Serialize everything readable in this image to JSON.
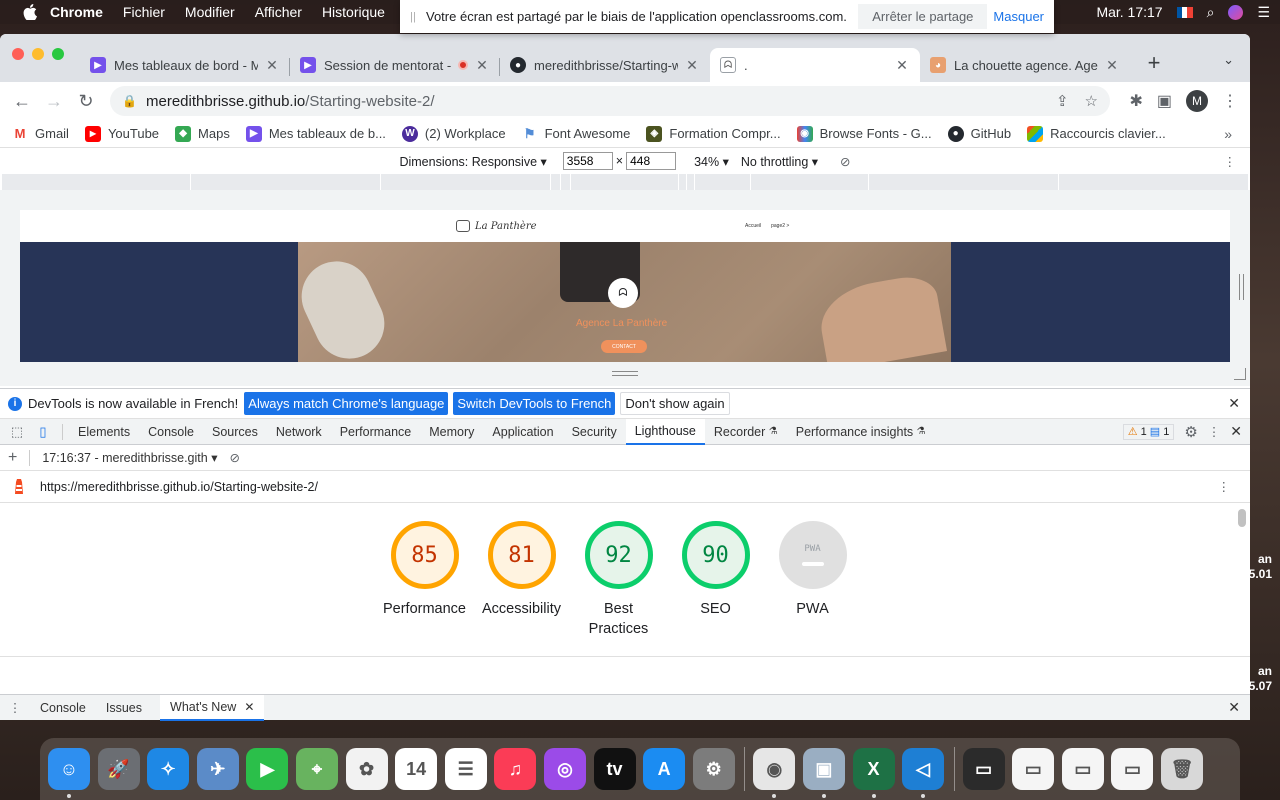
{
  "menubar": {
    "app_name": "Chrome",
    "items": [
      "Fichier",
      "Modifier",
      "Afficher",
      "Historique"
    ],
    "clock": "Mar. 17:17"
  },
  "share_banner": {
    "message": "Votre écran est partagé par le biais de l'application openclassrooms.com.",
    "stop_label": "Arrêter le partage",
    "hide_label": "Masquer"
  },
  "tabs": [
    {
      "title": "Mes tableaux de bord - M",
      "favicon_color": "#7451eb",
      "favicon": "openclassrooms-icon"
    },
    {
      "title": "Session de mentorat -",
      "favicon_color": "#7451eb",
      "favicon": "openclassrooms-icon",
      "recording": true
    },
    {
      "title": "meredithbrisse/Starting-w",
      "favicon_color": "#24292f",
      "favicon": "github-icon"
    },
    {
      "title": ".",
      "favicon_color": "#9aa0a6",
      "favicon": "panther-icon",
      "active": true
    },
    {
      "title": "La chouette agence. Ager",
      "favicon_color": "#e8a070",
      "favicon": "owl-icon"
    }
  ],
  "address": {
    "host": "meredithbrisse.github.io",
    "path": "/Starting-website-2/"
  },
  "profile_initial": "M",
  "bookmarks": [
    {
      "label": "Gmail",
      "color": "#ea4335",
      "glyph": "M"
    },
    {
      "label": "YouTube",
      "color": "#ff0000",
      "glyph": "▶"
    },
    {
      "label": "Maps",
      "color": "#34a853",
      "glyph": "◆"
    },
    {
      "label": "Mes tableaux de b...",
      "color": "#7451eb",
      "glyph": "▶"
    },
    {
      "label": "(2) Workplace",
      "color": "#4b2c9c",
      "glyph": "W"
    },
    {
      "label": "Font Awesome",
      "color": "#538dd7",
      "glyph": "⚑"
    },
    {
      "label": "Formation Compr...",
      "color": "#4b5320",
      "glyph": "◈"
    },
    {
      "label": "Browse Fonts - G...",
      "color": "#4285f4",
      "glyph": "◉"
    },
    {
      "label": "GitHub",
      "color": "#24292f",
      "glyph": "●"
    },
    {
      "label": "Raccourcis clavier...",
      "color": "#f25022",
      "glyph": "▦"
    }
  ],
  "device_toolbar": {
    "dimensions_label": "Dimensions: Responsive",
    "width": "3558",
    "height": "448",
    "zoom": "34%",
    "throttling": "No throttling"
  },
  "site": {
    "logo_text": "La Panthère",
    "nav": [
      "Accueil",
      "page2 >"
    ],
    "hero_title": "Agence La Panthère",
    "hero_button": "CONTACT"
  },
  "devtools": {
    "infobar": {
      "message": "DevTools is now available in French!",
      "btn_match": "Always match Chrome's language",
      "btn_switch": "Switch DevTools to French",
      "btn_dismiss": "Don't show again"
    },
    "tabs": [
      "Elements",
      "Console",
      "Sources",
      "Network",
      "Performance",
      "Memory",
      "Application",
      "Security",
      "Lighthouse",
      "Recorder",
      "Performance insights"
    ],
    "active_tab": "Lighthouse",
    "warnings_count": "1",
    "messages_count": "1",
    "lighthouse": {
      "report_time": "17:16:37 - meredithbrisse.gith",
      "url": "https://meredithbrisse.github.io/Starting-website-2/",
      "scores": [
        {
          "label": "Performance",
          "value": "85",
          "status": "orange"
        },
        {
          "label": "Accessibility",
          "value": "81",
          "status": "orange"
        },
        {
          "label": "Best Practices",
          "value": "92",
          "status": "green"
        },
        {
          "label": "SEO",
          "value": "90",
          "status": "green"
        },
        {
          "label": "PWA",
          "value": "",
          "status": "grey",
          "badge": "PWA"
        }
      ]
    },
    "drawer_tabs": [
      "Console",
      "Issues",
      "What's New"
    ],
    "drawer_active": "What's New"
  },
  "desktop_labels": [
    {
      "line1": "an",
      "line2": "5.01"
    },
    {
      "line1": "an",
      "line2": "5.07"
    }
  ],
  "dock": [
    {
      "name": "finder-icon",
      "color": "#2e8ff0",
      "glyph": "☺",
      "running": true
    },
    {
      "name": "launchpad-icon",
      "color": "#6b6e73",
      "glyph": "🚀",
      "running": false
    },
    {
      "name": "safari-icon",
      "color": "#1e88e5",
      "glyph": "✧",
      "running": false
    },
    {
      "name": "preview-icon",
      "color": "#5b8bc8",
      "glyph": "✈",
      "running": false
    },
    {
      "name": "facetime-icon",
      "color": "#2bbf4a",
      "glyph": "▶",
      "running": false
    },
    {
      "name": "maps-icon",
      "color": "#68b35f",
      "glyph": "⌖",
      "running": false
    },
    {
      "name": "photos-icon",
      "color": "#f2f2f2",
      "glyph": "✿",
      "running": false
    },
    {
      "name": "calendar-icon",
      "color": "#ffffff",
      "glyph": "14",
      "running": false
    },
    {
      "name": "reminders-icon",
      "color": "#ffffff",
      "glyph": "☰",
      "running": false
    },
    {
      "name": "music-icon",
      "color": "#fb3c56",
      "glyph": "♫",
      "running": false
    },
    {
      "name": "podcasts-icon",
      "color": "#9b4be8",
      "glyph": "◎",
      "running": false
    },
    {
      "name": "appletv-icon",
      "color": "#111111",
      "glyph": "tv",
      "running": false
    },
    {
      "name": "appstore-icon",
      "color": "#1b8cf2",
      "glyph": "A",
      "running": false
    },
    {
      "name": "system-preferences-icon",
      "color": "#7c7c7c",
      "glyph": "⚙",
      "running": false
    },
    {
      "name": "chrome-icon",
      "color": "#e6e6e6",
      "glyph": "◉",
      "running": true
    },
    {
      "name": "preview-photos-icon",
      "color": "#9aaec2",
      "glyph": "▣",
      "running": true
    },
    {
      "name": "excel-icon",
      "color": "#1e7145",
      "glyph": "X",
      "running": true
    },
    {
      "name": "vscode-icon",
      "color": "#1e7fd4",
      "glyph": "◁",
      "running": true
    },
    {
      "name": "window-thumb-1-icon",
      "color": "#2b2b2b",
      "glyph": "▭",
      "running": false
    },
    {
      "name": "window-thumb-2-icon",
      "color": "#f5f5f5",
      "glyph": "▭",
      "running": false
    },
    {
      "name": "window-thumb-3-icon",
      "color": "#f5f5f5",
      "glyph": "▭",
      "running": false
    },
    {
      "name": "window-thumb-4-icon",
      "color": "#f5f5f5",
      "glyph": "▭",
      "running": false
    },
    {
      "name": "trash-icon",
      "color": "#d8d8d8",
      "glyph": "🗑",
      "running": false
    }
  ]
}
